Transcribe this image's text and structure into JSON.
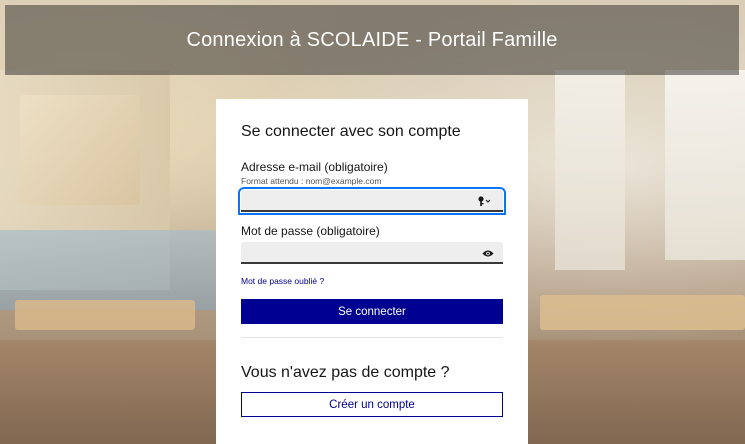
{
  "header": {
    "title": "Connexion à SCOLAIDE - Portail Famille"
  },
  "login": {
    "title": "Se connecter avec son compte",
    "email_label": "Adresse e-mail (obligatoire)",
    "email_hint": "Format attendu : nom@example.com",
    "email_value": "",
    "email_icon": "key-icon",
    "password_label": "Mot de passe (obligatoire)",
    "password_value": "",
    "password_icon": "eye-icon",
    "forgot_link": "Mot de passe oublié ?",
    "submit_label": "Se connecter"
  },
  "signup": {
    "title": "Vous n'avez pas de compte ?",
    "create_label": "Créer un compte"
  },
  "colors": {
    "primary": "#000091",
    "focus": "#0a76f6"
  }
}
